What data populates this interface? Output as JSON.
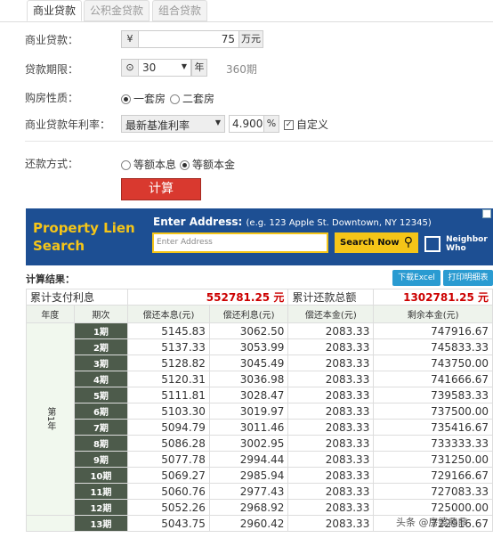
{
  "tabs": [
    "商业贷款",
    "公积金贷款",
    "组合贷款"
  ],
  "form": {
    "loan_label": "商业贷款：",
    "currency": "¥",
    "loan_amount": "75",
    "loan_unit": "万元",
    "term_label": "贷款期限：",
    "term_value": "30",
    "term_unit": "年",
    "term_periods": "360期",
    "property_label": "购房性质：",
    "property_options": [
      "一套房",
      "二套房"
    ],
    "property_selected": "一套房",
    "rate_label": "商业贷款年利率：",
    "rate_select": "最新基准利率",
    "rate_value": "4.900",
    "rate_unit": "%",
    "custom_label": "自定义",
    "repay_label": "还款方式：",
    "repay_options": [
      "等额本息",
      "等额本金"
    ],
    "repay_selected": "等额本金",
    "calc_label": "计算"
  },
  "ad": {
    "title": "Property Lien Search",
    "enter_label": "Enter Address:",
    "enter_hint": "(e.g. 123 Apple St. Downtown, NY 12345)",
    "input_placeholder": "Enter Address",
    "button": "Search Now",
    "logo": "Neighbor Who"
  },
  "results": {
    "label": "计算结果：",
    "export_excel": "下载Excel",
    "print_detail": "打印明细表",
    "total_interest_label": "累计支付利息",
    "total_interest": "552781.25 元",
    "total_repay_label": "累计还款总额",
    "total_repay": "1302781.25 元",
    "headers": [
      "年度",
      "期次",
      "偿还本息(元)",
      "偿还利息(元)",
      "偿还本金(元)",
      "剩余本金(元)"
    ],
    "year_label": "第1年",
    "rows": [
      [
        "1期",
        "5145.83",
        "3062.50",
        "2083.33",
        "747916.67"
      ],
      [
        "2期",
        "5137.33",
        "3053.99",
        "2083.33",
        "745833.33"
      ],
      [
        "3期",
        "5128.82",
        "3045.49",
        "2083.33",
        "743750.00"
      ],
      [
        "4期",
        "5120.31",
        "3036.98",
        "2083.33",
        "741666.67"
      ],
      [
        "5期",
        "5111.81",
        "3028.47",
        "2083.33",
        "739583.33"
      ],
      [
        "6期",
        "5103.30",
        "3019.97",
        "2083.33",
        "737500.00"
      ],
      [
        "7期",
        "5094.79",
        "3011.46",
        "2083.33",
        "735416.67"
      ],
      [
        "8期",
        "5086.28",
        "3002.95",
        "2083.33",
        "733333.33"
      ],
      [
        "9期",
        "5077.78",
        "2994.44",
        "2083.33",
        "731250.00"
      ],
      [
        "10期",
        "5069.27",
        "2985.94",
        "2083.33",
        "729166.67"
      ],
      [
        "11期",
        "5060.76",
        "2977.43",
        "2083.33",
        "727083.33"
      ],
      [
        "12期",
        "5052.26",
        "2968.92",
        "2083.33",
        "725000.00"
      ],
      [
        "13期",
        "5043.75",
        "2960.42",
        "2083.33",
        "722916.67"
      ]
    ]
  },
  "watermark": "头条 @房婆鼎鼎"
}
